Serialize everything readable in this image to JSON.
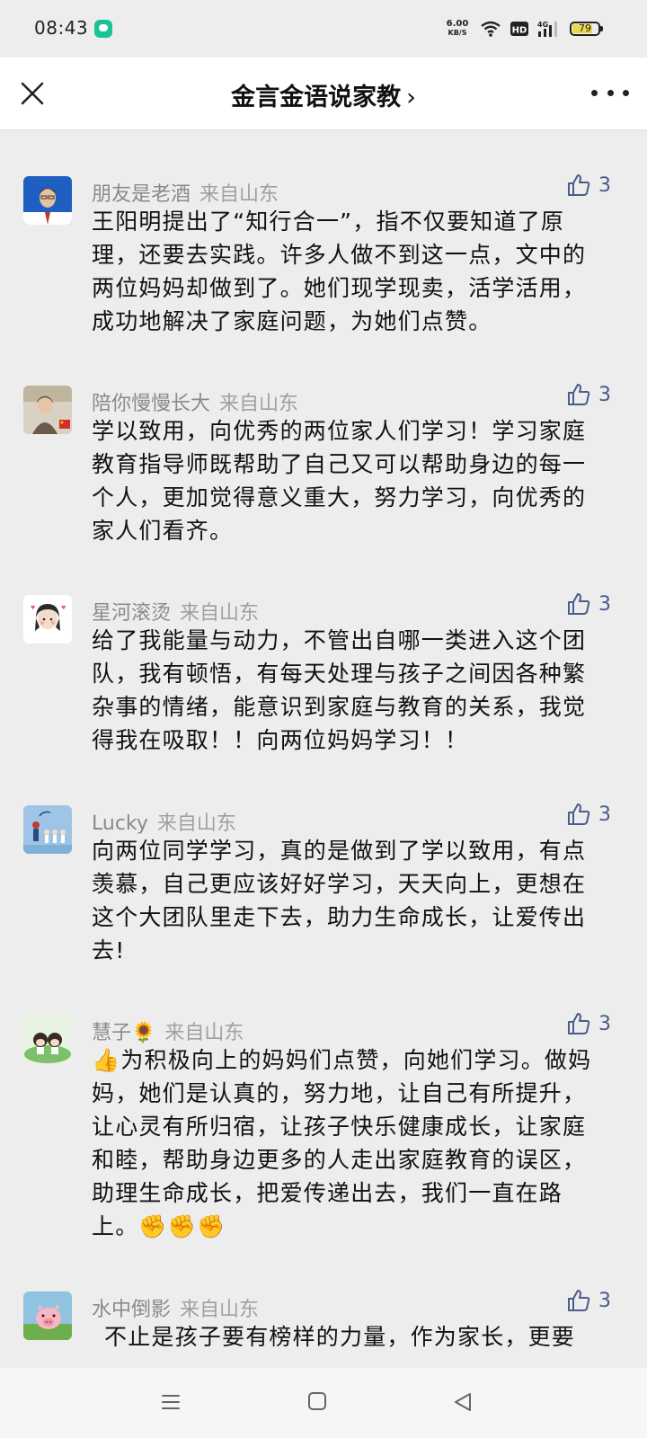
{
  "status_bar": {
    "time": "08:43",
    "net_speed_value": "6.00",
    "net_speed_unit": "KB/S",
    "network": "4G",
    "battery": "79",
    "battery_level": 0.79
  },
  "header": {
    "title": "金言金语说家教",
    "chevron": "›"
  },
  "comments": [
    {
      "name": "朋友是老酒",
      "location": "来自山东",
      "likes": "3",
      "text": "王阳明提出了“知行合一”，指不仅要知道了原理，还要去实践。许多人做不到这一点，文中的两位妈妈却做到了。她们现学现卖，活学活用，成功地解决了家庭问题，为她们点赞。"
    },
    {
      "name": "陪你慢慢长大",
      "location": "来自山东",
      "likes": "3",
      "text": "学以致用，向优秀的两位家人们学习！学习家庭教育指导师既帮助了自己又可以帮助身边的每一个人，更加觉得意义重大，努力学习，向优秀的家人们看齐。"
    },
    {
      "name": "星河滚烫",
      "location": "来自山东",
      "likes": "3",
      "text": "给了我能量与动力，不管出自哪一类进入这个团队，我有顿悟，有每天处理与孩子之间因各种繁杂事的情绪，能意识到家庭与教育的关系，我觉得我在吸取！！向两位妈妈学习！！"
    },
    {
      "name": "Lucky",
      "location": "来自山东",
      "likes": "3",
      "text": "向两位同学学习，真的是做到了学以致用，有点羡慕，自己更应该好好学习，天天向上，更想在这个大团队里走下去，助力生命成长，让爱传出去!"
    },
    {
      "name": "慧子🌻",
      "location": "来自山东",
      "likes": "3",
      "text": "👍为积极向上的妈妈们点赞，向她们学习。做妈妈，她们是认真的，努力地，让自己有所提升，让心灵有所归宿，让孩子快乐健康成长，让家庭和睦，帮助身边更多的人走出家庭教育的误区，助理生命成长，把爱传递出去，我们一直在路上。✊✊✊"
    },
    {
      "name": "水中倒影",
      "location": "来自山东",
      "likes": "3",
      "text": "不止是孩子要有榜样的力量，作为家长，更要"
    }
  ]
}
